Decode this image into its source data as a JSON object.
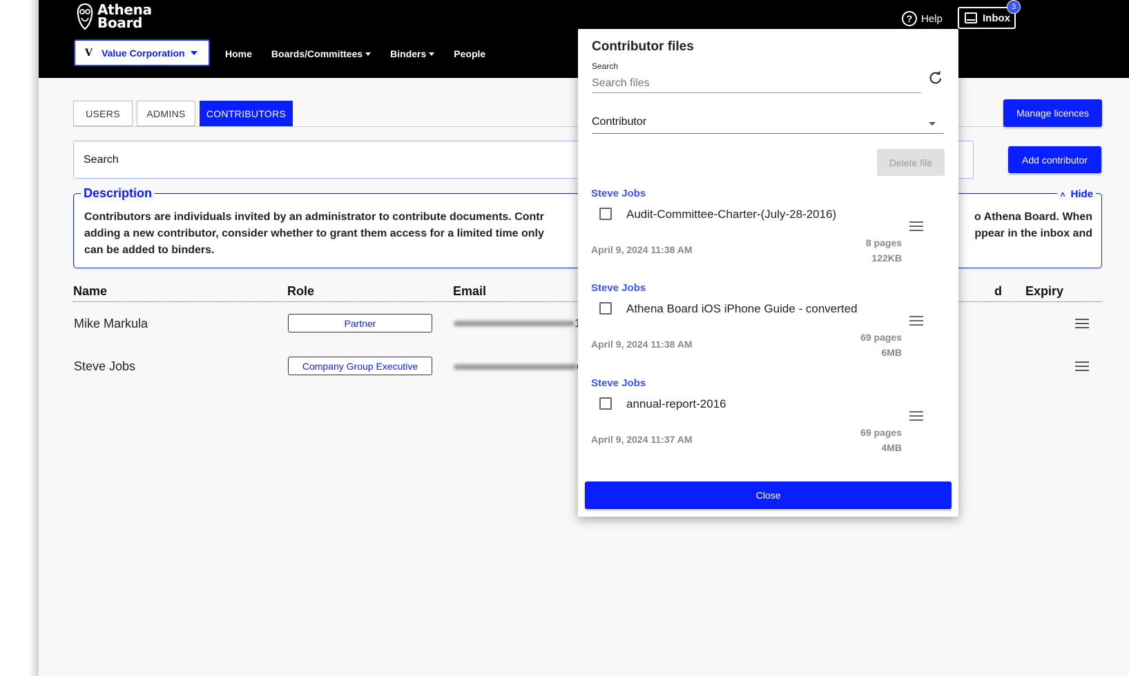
{
  "brand": {
    "name_line1": "Athena",
    "name_line2": "Board"
  },
  "header": {
    "org_badge": "V",
    "org_name": "Value Corporation",
    "nav": [
      "Home",
      "Boards/Committees",
      "Binders",
      "People"
    ],
    "help_label": "Help",
    "inbox_label": "Inbox",
    "inbox_count": "3"
  },
  "tabs": [
    "USERS",
    "ADMINS",
    "CONTRIBUTORS"
  ],
  "active_tab": "CONTRIBUTORS",
  "buttons": {
    "manage_licences": "Manage licences",
    "add_contributor": "Add contributor"
  },
  "search": {
    "label": "Search"
  },
  "description": {
    "title": "Description",
    "hide_label": "Hide",
    "line1a": "Contributors are individuals invited by an administrator to contribute documents. Contr",
    "line1b": "o Athena Board. When",
    "line2a": "adding a new contributor, consider whether to grant them access for a limited time only",
    "line2b": "ppear in the inbox and",
    "line3": "can be added to binders."
  },
  "table": {
    "headers": {
      "name": "Name",
      "role": "Role",
      "email": "Email",
      "partial": "d",
      "expiry": "Expiry"
    },
    "rows": [
      {
        "name": "Mike Markula",
        "role": "Partner",
        "email_tail": "1"
      },
      {
        "name": "Steve Jobs",
        "role": "Company Group Executive",
        "email_tail": "c"
      }
    ]
  },
  "modal": {
    "title": "Contributor files",
    "search_label": "Search",
    "search_placeholder": "Search files",
    "contributor_select": "Contributor",
    "delete_label": "Delete file",
    "close_label": "Close",
    "files": [
      {
        "owner": "Steve Jobs",
        "name": "Audit-Committee-Charter-(July-28-2016)",
        "date": "April 9, 2024 11:38 AM",
        "pages": "8 pages",
        "size": "122KB"
      },
      {
        "owner": "Steve Jobs",
        "name": "Athena Board iOS iPhone Guide - converted",
        "date": "April 9, 2024 11:38 AM",
        "pages": "69 pages",
        "size": "6MB"
      },
      {
        "owner": "Steve Jobs",
        "name": "annual-report-2016",
        "date": "April 9, 2024 11:37 AM",
        "pages": "69 pages",
        "size": "4MB"
      }
    ]
  },
  "colors": {
    "accent": "#0a1fff",
    "owner_link": "#3a52ff",
    "topbar": "#000000"
  },
  "icons": [
    "owl-logo-icon",
    "help-icon",
    "inbox-icon",
    "refresh-icon",
    "hamburger-icon",
    "chevron-up-icon",
    "caret-down-icon",
    "checkbox-icon"
  ]
}
